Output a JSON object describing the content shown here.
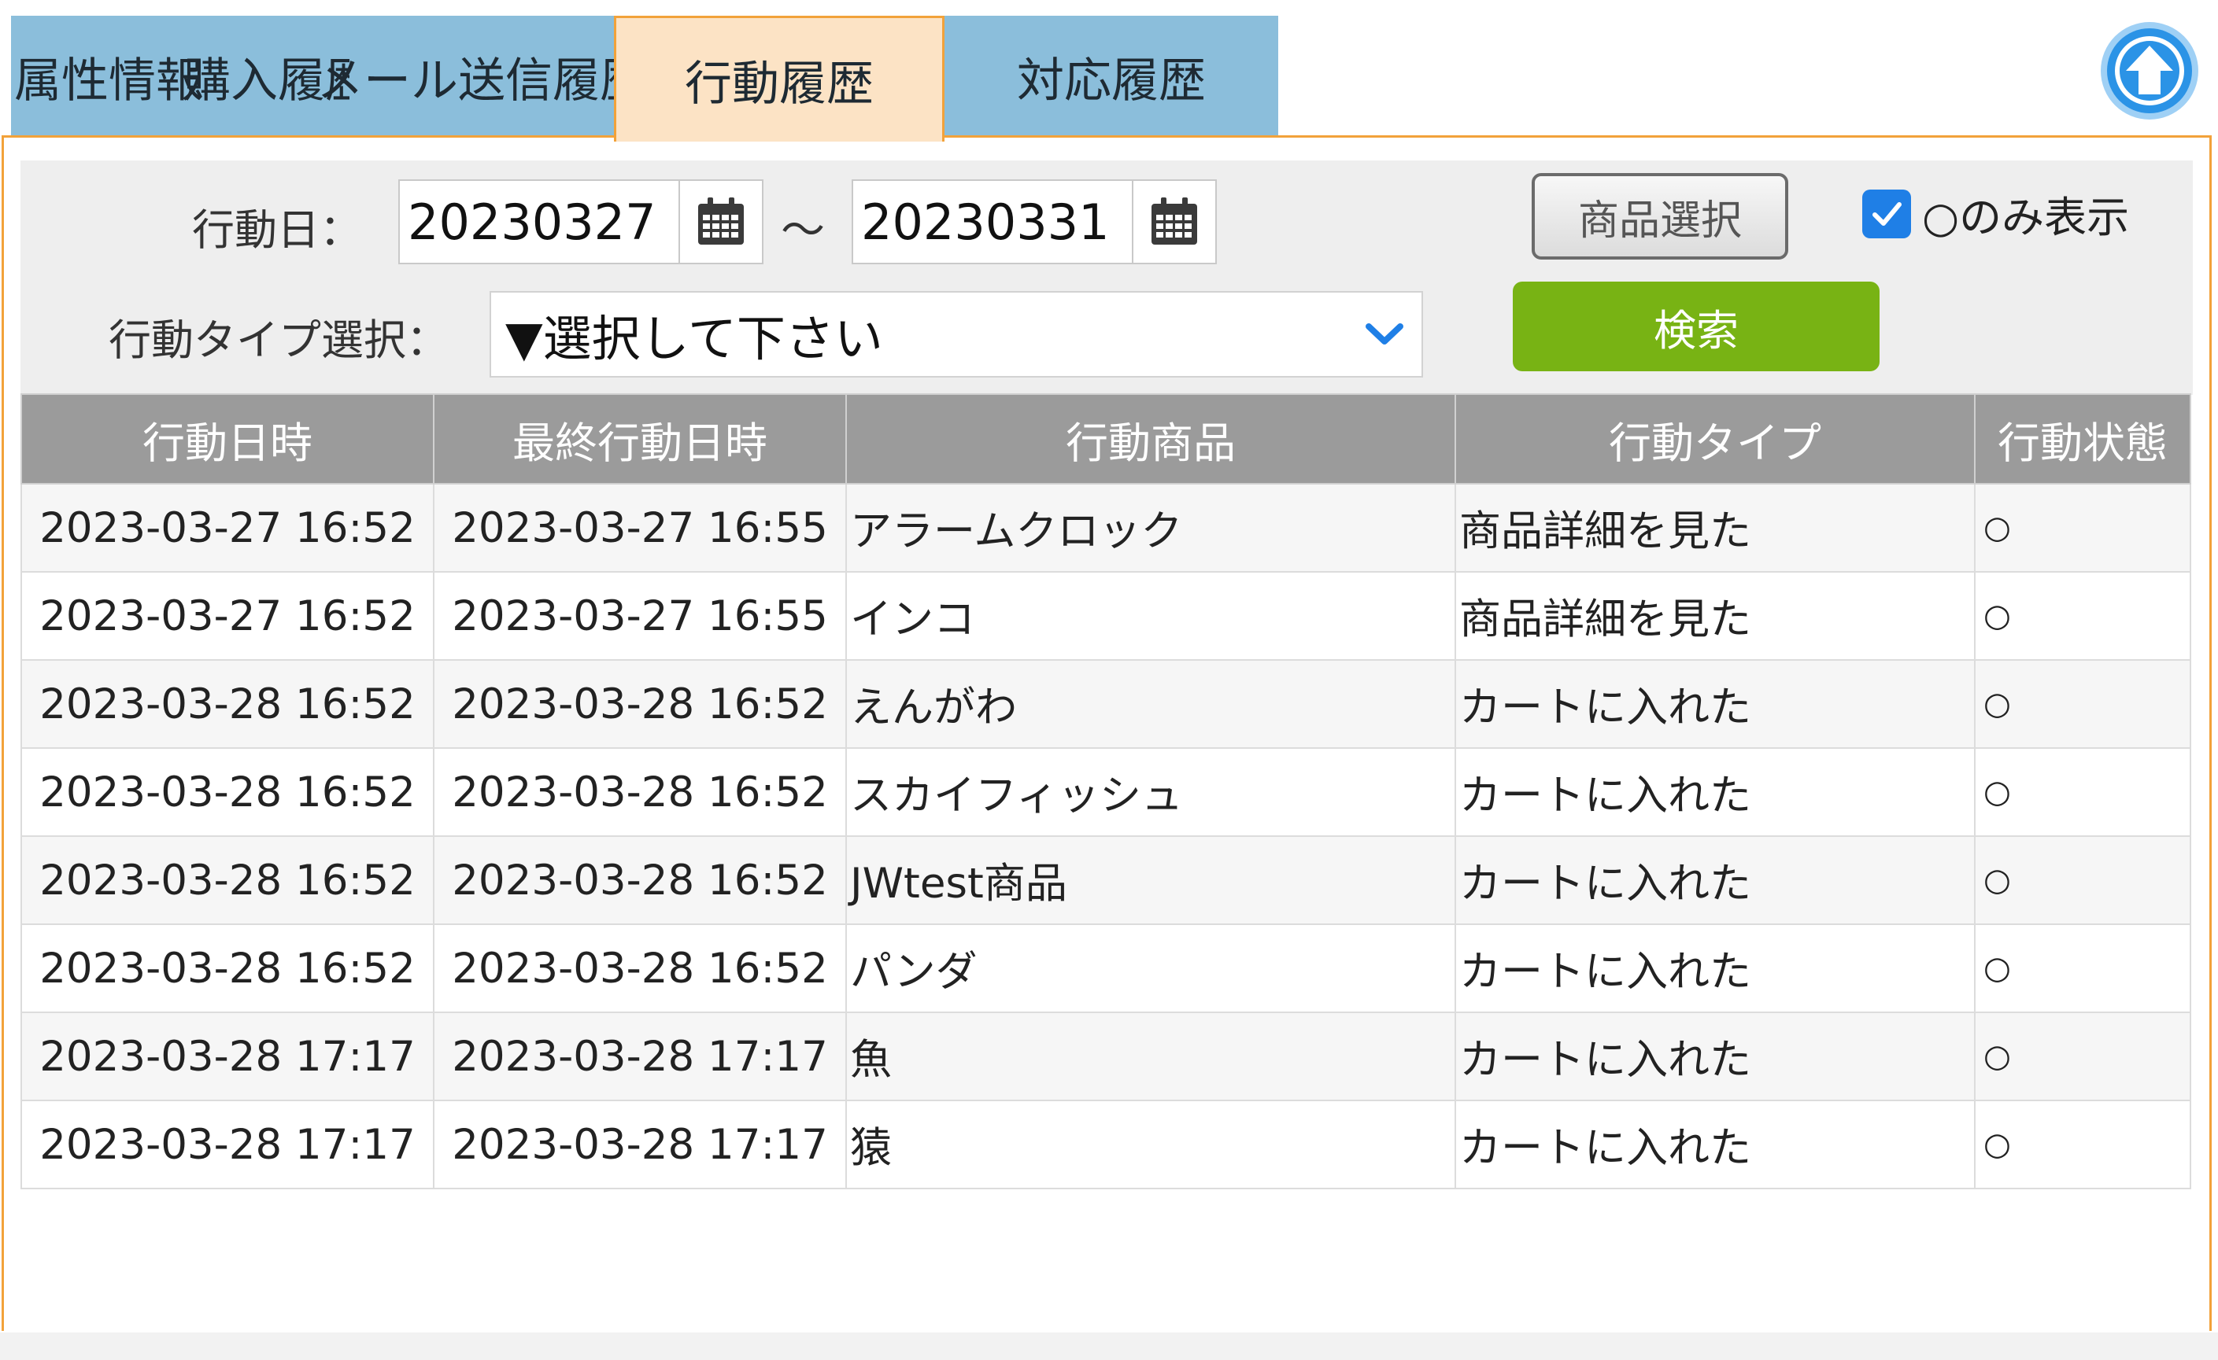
{
  "tabs": [
    {
      "label": "属性情報",
      "active": false
    },
    {
      "label": "購入履歴",
      "active": false
    },
    {
      "label": "メール送信履歴",
      "active": false
    },
    {
      "label": "行動履歴",
      "active": true
    },
    {
      "label": "対応履歴",
      "active": false
    }
  ],
  "filter": {
    "date_label": "行動日：",
    "date_from": "20230327",
    "date_separator": "～",
    "date_to": "20230331",
    "type_label": "行動タイプ選択：",
    "type_selected": "▼選択して下さい",
    "product_button": "商品選択",
    "only_label": "○のみ表示",
    "only_checked": true,
    "search_button": "検索"
  },
  "table": {
    "headers": [
      "行動日時",
      "最終行動日時",
      "行動商品",
      "行動タイプ",
      "行動状態"
    ],
    "rows": [
      [
        "2023-03-27 16:52",
        "2023-03-27 16:55",
        "アラームクロック",
        "商品詳細を見た",
        "○"
      ],
      [
        "2023-03-27 16:52",
        "2023-03-27 16:55",
        "インコ",
        "商品詳細を見た",
        "○"
      ],
      [
        "2023-03-28 16:52",
        "2023-03-28 16:52",
        "えんがわ",
        "カートに入れた",
        "○"
      ],
      [
        "2023-03-28 16:52",
        "2023-03-28 16:52",
        "スカイフィッシュ",
        "カートに入れた",
        "○"
      ],
      [
        "2023-03-28 16:52",
        "2023-03-28 16:52",
        "JWtest商品",
        "カートに入れた",
        "○"
      ],
      [
        "2023-03-28 16:52",
        "2023-03-28 16:52",
        "パンダ",
        "カートに入れた",
        "○"
      ],
      [
        "2023-03-28 17:17",
        "2023-03-28 17:17",
        "魚",
        "カートに入れた",
        "○"
      ],
      [
        "2023-03-28 17:17",
        "2023-03-28 17:17",
        "猿",
        "カートに入れた",
        "○"
      ]
    ]
  },
  "icons": {
    "calendar": "calendar-icon",
    "chevron": "chevron-down-icon",
    "scroll_top": "arrow-up-circle-icon",
    "checkbox": "checkmark-icon"
  },
  "colors": {
    "tab_bg": "#8bbedb",
    "tab_active_bg": "#fce3c5",
    "accent_orange": "#f2a23a",
    "search_green": "#78b314",
    "header_gray": "#9b9b9b",
    "checkbox_blue": "#1f7fe6",
    "scroll_top_blue": "#2b93e6"
  }
}
